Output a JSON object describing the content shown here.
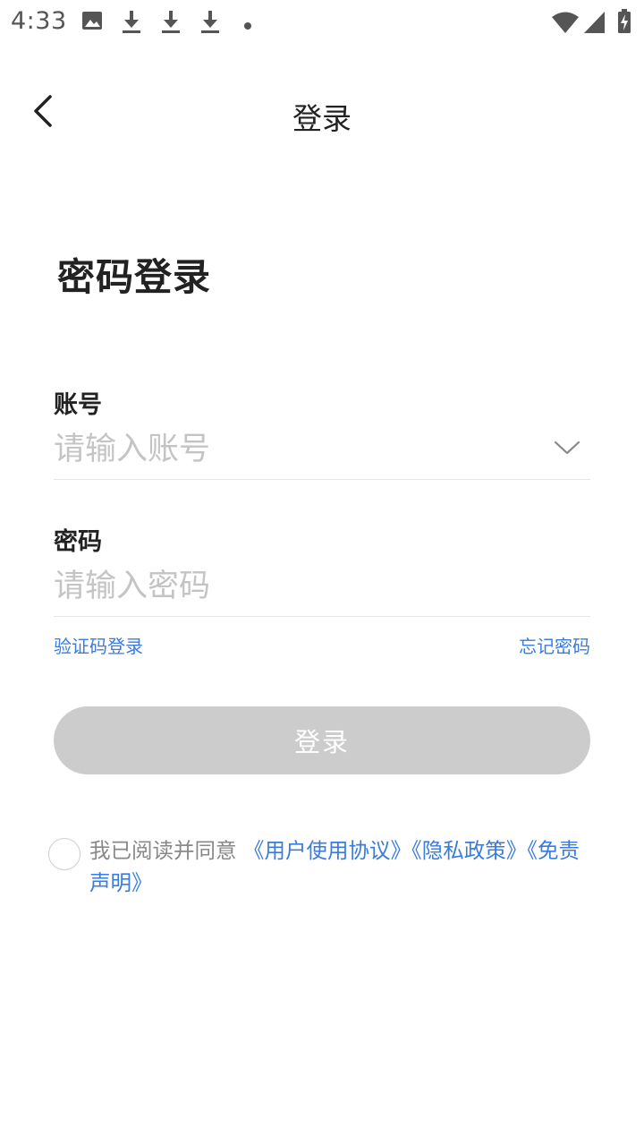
{
  "status_bar": {
    "time": "4:33",
    "icons": [
      "image-icon",
      "download-icon",
      "download-icon",
      "download-icon",
      "dot-icon",
      "wifi-icon",
      "signal-icon",
      "battery-charging-icon"
    ]
  },
  "header": {
    "back_icon": "chevron-left-icon",
    "title": "登录"
  },
  "page": {
    "heading": "密码登录"
  },
  "account": {
    "label": "账号",
    "placeholder": "请输入账号",
    "value": "",
    "dropdown_icon": "chevron-down-icon"
  },
  "password": {
    "label": "密码",
    "placeholder": "请输入密码",
    "value": ""
  },
  "links": {
    "sms_login": "验证码登录",
    "forgot_password": "忘记密码"
  },
  "login_button": {
    "label": "登录"
  },
  "agreement": {
    "checked": false,
    "prefix": "我已阅读并同意 ",
    "user_agreement": "《用户使用协议》",
    "privacy_policy": "《隐私政策》",
    "disclaimer": "《免责声明》"
  },
  "colors": {
    "accent": "#3a7be0",
    "button_disabled": "#cccccc",
    "placeholder": "#c4c4c4",
    "divider": "#e6e6e6"
  }
}
